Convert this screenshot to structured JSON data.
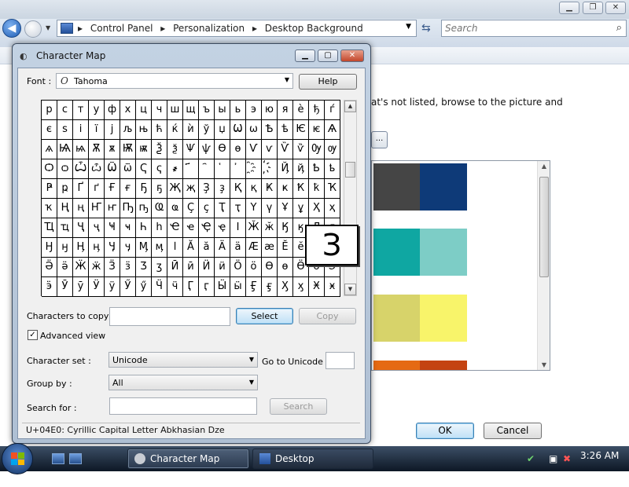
{
  "bg_window": {
    "breadcrumbs": [
      "Control Panel",
      "Personalization",
      "Desktop Background"
    ],
    "search_placeholder": "Search",
    "description": "at's not listed, browse to the picture and",
    "browse_label": "...",
    "swatch_colors": [
      "#454545",
      "#0e3a78",
      "#0fa7a2",
      "#7dcdc6",
      "#d7d36a",
      "#f8f46a",
      "#e56a13",
      "#c44312"
    ],
    "ok_label": "OK",
    "cancel_label": "Cancel"
  },
  "charmap": {
    "title": "Character Map",
    "font_label": "Font :",
    "font_value": "Tahoma",
    "font_icon_glyph": "O",
    "help_label": "Help",
    "grid": [
      [
        "р",
        "с",
        "т",
        "у",
        "ф",
        "х",
        "ц",
        "ч",
        "ш",
        "щ",
        "ъ",
        "ы",
        "ь",
        "э",
        "ю",
        "я",
        "è",
        "ђ",
        "ѓ"
      ],
      [
        "є",
        "ѕ",
        "і",
        "ї",
        "ј",
        "љ",
        "њ",
        "ћ",
        "ќ",
        "ѝ",
        "ў",
        "џ",
        "Ѡ",
        "ѡ",
        "Ѣ",
        "ѣ",
        "Ѥ",
        "ѥ",
        "Ѧ"
      ],
      [
        "ѧ",
        "Ѩ",
        "ѩ",
        "Ѫ",
        "ѫ",
        "Ѭ",
        "ѭ",
        "Ѯ",
        "ѯ",
        "Ѱ",
        "ѱ",
        "Ѳ",
        "ѳ",
        "Ѵ",
        "ѵ",
        "Ѷ",
        "ѷ",
        "Ѹ",
        "ѹ"
      ],
      [
        "Ѻ",
        "ѻ",
        "Ѽ",
        "ѽ",
        "Ѿ",
        "ѿ",
        "Ҁ",
        "ҁ",
        "҂",
        "҃",
        "҄",
        "҅",
        "҆",
        "҈",
        "҉",
        "Ҋ",
        "ҋ",
        "Ҍ",
        "ҍ"
      ],
      [
        "Ҏ",
        "ҏ",
        "Ґ",
        "ґ",
        "Ғ",
        "ғ",
        "Ҕ",
        "ҕ",
        "Җ",
        "җ",
        "Ҙ",
        "ҙ",
        "Қ",
        "қ",
        "Ҝ",
        "ҝ",
        "Ҟ",
        "ҟ",
        "Ҡ"
      ],
      [
        "ҡ",
        "Ң",
        "ң",
        "Ҥ",
        "ҥ",
        "Ҧ",
        "ҧ",
        "Ҩ",
        "ҩ",
        "Ҫ",
        "ҫ",
        "Ҭ",
        "ҭ",
        "Ү",
        "ү",
        "Ұ",
        "ұ",
        "Ҳ",
        "ҳ"
      ],
      [
        "Ҵ",
        "ҵ",
        "Ҷ",
        "ҷ",
        "Ҹ",
        "ҹ",
        "Һ",
        "һ",
        "Ҽ",
        "ҽ",
        "Ҿ",
        "ҿ",
        "Ӏ",
        "Ӂ",
        "ӂ",
        "Ӄ",
        "ӄ",
        "Ӆ",
        "ӆ"
      ],
      [
        "Ӈ",
        "ӈ",
        "Ӊ",
        "ӊ",
        "Ӌ",
        "ӌ",
        "Ӎ",
        "ӎ",
        "ӏ",
        "Ӑ",
        "ӑ",
        "Ӓ",
        "ӓ",
        "Ӕ",
        "ӕ",
        "Ӗ",
        "ӗ",
        "Ә",
        "ә"
      ],
      [
        "Ӛ",
        "ӛ",
        "Ӝ",
        "ӝ",
        "Ӟ",
        "ӟ",
        "Ӡ",
        "ӡ",
        "Ӣ",
        "ӣ",
        "Ӥ",
        "ӥ",
        "Ӧ",
        "ӧ",
        "Ө",
        "ө",
        "Ӫ",
        "ӫ",
        "Ӭ"
      ],
      [
        "ӭ",
        "Ӯ",
        "ӯ",
        "Ӱ",
        "ӱ",
        "Ӳ",
        "ӳ",
        "Ӵ",
        "ӵ",
        "Ӷ",
        "ӷ",
        "Ӹ",
        "ӹ",
        "Ӻ",
        "ӻ",
        "Ӽ",
        "ӽ",
        "Ӿ",
        "ӿ"
      ]
    ],
    "zoom_char": "З",
    "chars_to_copy_label": "Characters to copy",
    "chars_to_copy_value": "",
    "select_label": "Select",
    "copy_label": "Copy",
    "advanced_view_label": "Advanced view",
    "advanced_view_checked": "✓",
    "charset_label": "Character set :",
    "charset_value": "Unicode",
    "goto_unicode_label": "Go to Unicode :",
    "goto_unicode_value": "",
    "groupby_label": "Group by :",
    "groupby_value": "All",
    "searchfor_label": "Search for :",
    "searchfor_value": "",
    "search_label": "Search",
    "status": "U+04E0: Cyrillic Capital Letter Abkhasian Dze"
  },
  "taskbar": {
    "items": [
      {
        "label": "Character Map"
      },
      {
        "label": "Desktop Background"
      }
    ],
    "clock": "3:26 AM"
  }
}
